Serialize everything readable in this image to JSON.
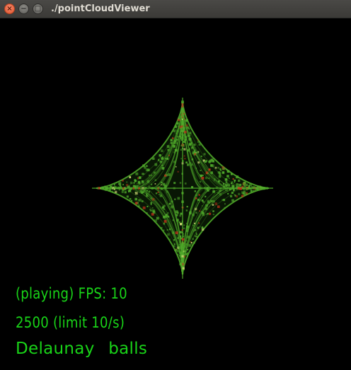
{
  "window": {
    "title": "./pointCloudViewer",
    "buttons": {
      "close_icon": "×",
      "minimize_icon": "−",
      "maximize_icon": "□"
    }
  },
  "colors": {
    "hud_text": "#19d418",
    "cloud_green": "#4fa82a",
    "cloud_red": "#c0301a",
    "cloud_yellow": "#d6e07a"
  },
  "hud": {
    "status_line": "(playing) FPS: 10",
    "points_line": "2500 (limit 10/s)",
    "mode_line": "Delaunay balls"
  }
}
